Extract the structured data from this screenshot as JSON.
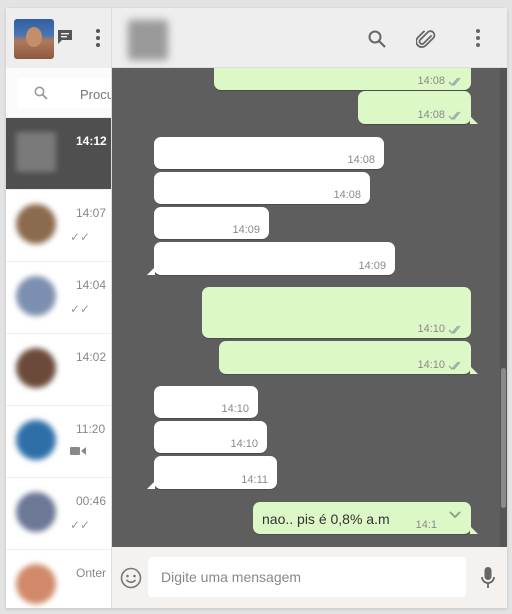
{
  "sidebar": {
    "search": {
      "placeholder": "Procurar"
    },
    "chats": [
      {
        "time": "14:12",
        "status": "",
        "avatar_color": "#7a7a7a",
        "active": true
      },
      {
        "time": "14:07",
        "status": "✓✓",
        "avatar_color": "#8b6b4e"
      },
      {
        "time": "14:04",
        "status": "✓✓",
        "avatar_color": "#7d8fb0"
      },
      {
        "time": "14:02",
        "status": "",
        "avatar_color": "#6b4a3a"
      },
      {
        "time": "11:20",
        "status": "video",
        "avatar_color": "#2f6fa8"
      },
      {
        "time": "00:46",
        "status": "✓✓",
        "avatar_color": "#6b7896"
      },
      {
        "time": "Onter",
        "status": "",
        "avatar_color": "#d08a6a"
      }
    ]
  },
  "messages": [
    {
      "dir": "out",
      "time": "14:08",
      "ticks": true
    },
    {
      "dir": "out",
      "time": "14:08",
      "ticks": true
    },
    {
      "dir": "in",
      "time": "14:08"
    },
    {
      "dir": "in",
      "time": "14:08"
    },
    {
      "dir": "in",
      "time": "14:09"
    },
    {
      "dir": "in",
      "time": "14:09"
    },
    {
      "dir": "out",
      "time": "14:10",
      "ticks": true
    },
    {
      "dir": "out",
      "time": "14:10",
      "ticks": true
    },
    {
      "dir": "in",
      "time": "14:10"
    },
    {
      "dir": "in",
      "time": "14:10"
    },
    {
      "dir": "in",
      "time": "14:11"
    },
    {
      "dir": "out",
      "text": "nao.. pis é 0,8% a.m",
      "time": "14:1"
    }
  ],
  "composer": {
    "placeholder": "Digite uma mensagem"
  },
  "colors": {
    "outgoing": "#dcf8c6",
    "incoming": "#ffffff",
    "chat_bg": "#5e5e5e",
    "ticks": "#9aa6a0"
  }
}
